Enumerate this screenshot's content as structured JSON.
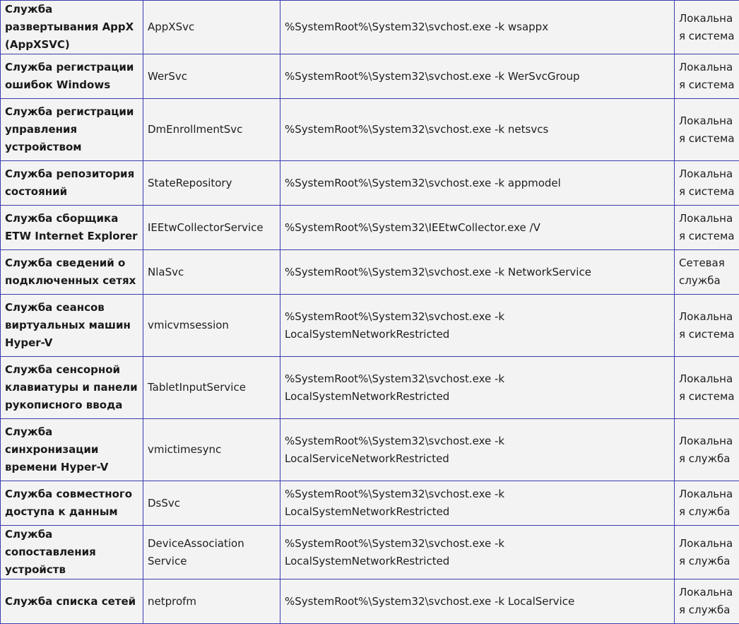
{
  "services": [
    {
      "name": "Служба развертывания AppX (AppXSVC)",
      "short": "AppXSvc",
      "path": "%SystemRoot%\\System32\\svchost.exe -k wsappx",
      "account": "Локальная система",
      "lines": 2
    },
    {
      "name": "Служба регистрации ошибок Windows",
      "short": "WerSvc",
      "path": "%SystemRoot%\\System32\\svchost.exe -k WerSvcGroup",
      "account": "Локальная система",
      "lines": 2
    },
    {
      "name": "Служба регистрации управления устройством",
      "short": "DmEnrollmentSvc",
      "path": "%SystemRoot%\\System32\\svchost.exe -k netsvcs",
      "account": "Локальная система",
      "lines": 3
    },
    {
      "name": "Служба репозитория состояний",
      "short": "StateRepository",
      "path": "%SystemRoot%\\System32\\svchost.exe -k appmodel",
      "account": "Локальная система",
      "lines": 2
    },
    {
      "name": "Служба сборщика ETW Internet Explorer",
      "short": "IEEtwCollectorService",
      "path": "%SystemRoot%\\System32\\IEEtwCollector.exe /V",
      "account": "Локальная система",
      "lines": 2
    },
    {
      "name": "Служба сведений о подключенных сетях",
      "short": "NlaSvc",
      "path": "%SystemRoot%\\System32\\svchost.exe -k NetworkService",
      "account": "Сетевая служба",
      "lines": 2
    },
    {
      "name": "Служба сеансов виртуальных машин Hyper-V",
      "short": "vmicvmsession",
      "path": "%SystemRoot%\\System32\\svchost.exe -k LocalSystemNetworkRestricted",
      "account": "Локальная система",
      "lines": 3
    },
    {
      "name": "Служба сенсорной клавиатуры и панели рукописного ввода",
      "short": "TabletInputService",
      "path": "%SystemRoot%\\System32\\svchost.exe -k LocalSystemNetworkRestricted",
      "account": "Локальная система",
      "lines": 3
    },
    {
      "name": "Служба синхронизации времени Hyper-V",
      "short": "vmictimesync",
      "path": "%SystemRoot%\\System32\\svchost.exe -k LocalServiceNetworkRestricted",
      "account": "Локальная служба",
      "lines": 3
    },
    {
      "name": "Служба совместного доступа к данным",
      "short": "DsSvc",
      "path": "%SystemRoot%\\System32\\svchost.exe -k LocalSystemNetworkRestricted",
      "account": "Локальная служба",
      "lines": 2
    },
    {
      "name": "Служба сопоставления устройств",
      "short": "DeviceAssociation Service",
      "path": "%SystemRoot%\\System32\\svchost.exe -k LocalSystemNetworkRestricted",
      "account": "Локальная служба",
      "lines": 2
    },
    {
      "name": "Служба списка сетей",
      "short": "netprofm",
      "path": "%SystemRoot%\\System32\\svchost.exe -k LocalService",
      "account": "Локальная служба",
      "lines": 2
    }
  ]
}
